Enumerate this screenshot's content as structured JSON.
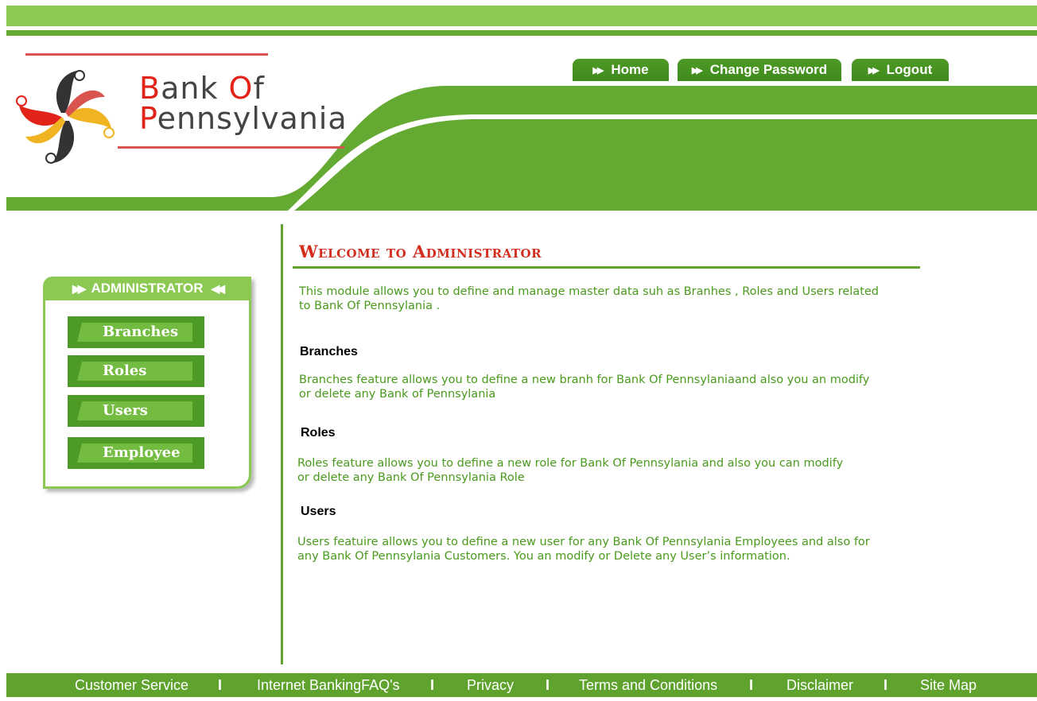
{
  "brand": {
    "line1_first": "B",
    "line1_rest": "ank ",
    "line1_o": "O",
    "line1_end": "f",
    "line2_first": "P",
    "line2_rest": "ennsylvania"
  },
  "nav": {
    "home": "Home",
    "change_password": "Change Password",
    "logout": "Logout"
  },
  "sidebar": {
    "title": "ADMINISTRATOR",
    "items": [
      {
        "label": "Branches"
      },
      {
        "label": "Roles"
      },
      {
        "label": "Users"
      },
      {
        "label": "Employee"
      }
    ]
  },
  "main": {
    "title": "Welcome to Administrator",
    "intro_1": "This module allows you to define and manage master data suh as Branhes , Roles and Users related",
    "intro_2": "to Bank Of Pennsylania .",
    "sections": [
      {
        "heading": "Branches",
        "line1": "Branches feature allows you to define a new branh for Bank Of Pennsylaniaand also you an modify",
        "line2": "or delete any Bank of Pennsylania"
      },
      {
        "heading": "Roles",
        "line1": "Roles feature allows you to define a new role for Bank Of Pennsylania and also you can modify",
        "line2": "or delete any Bank Of Pennsylania Role"
      },
      {
        "heading": "Users",
        "line1": "Users featuire allows you to define a new user for any Bank Of Pennsylania Employees and also for",
        "line2": "any Bank Of Pennsylania Customers. You an modify or Delete any User’s information."
      }
    ]
  },
  "footer": {
    "links": [
      "Customer Service",
      "Internet BankingFAQ's",
      "Privacy",
      "Terms and Conditions",
      "Disclaimer",
      "Site Map"
    ],
    "separator": "I"
  },
  "colors": {
    "green_light": "#8cc953",
    "green_dark": "#4e9a26",
    "accent_red": "#d32d1e",
    "text_green": "#4a9a1e"
  }
}
